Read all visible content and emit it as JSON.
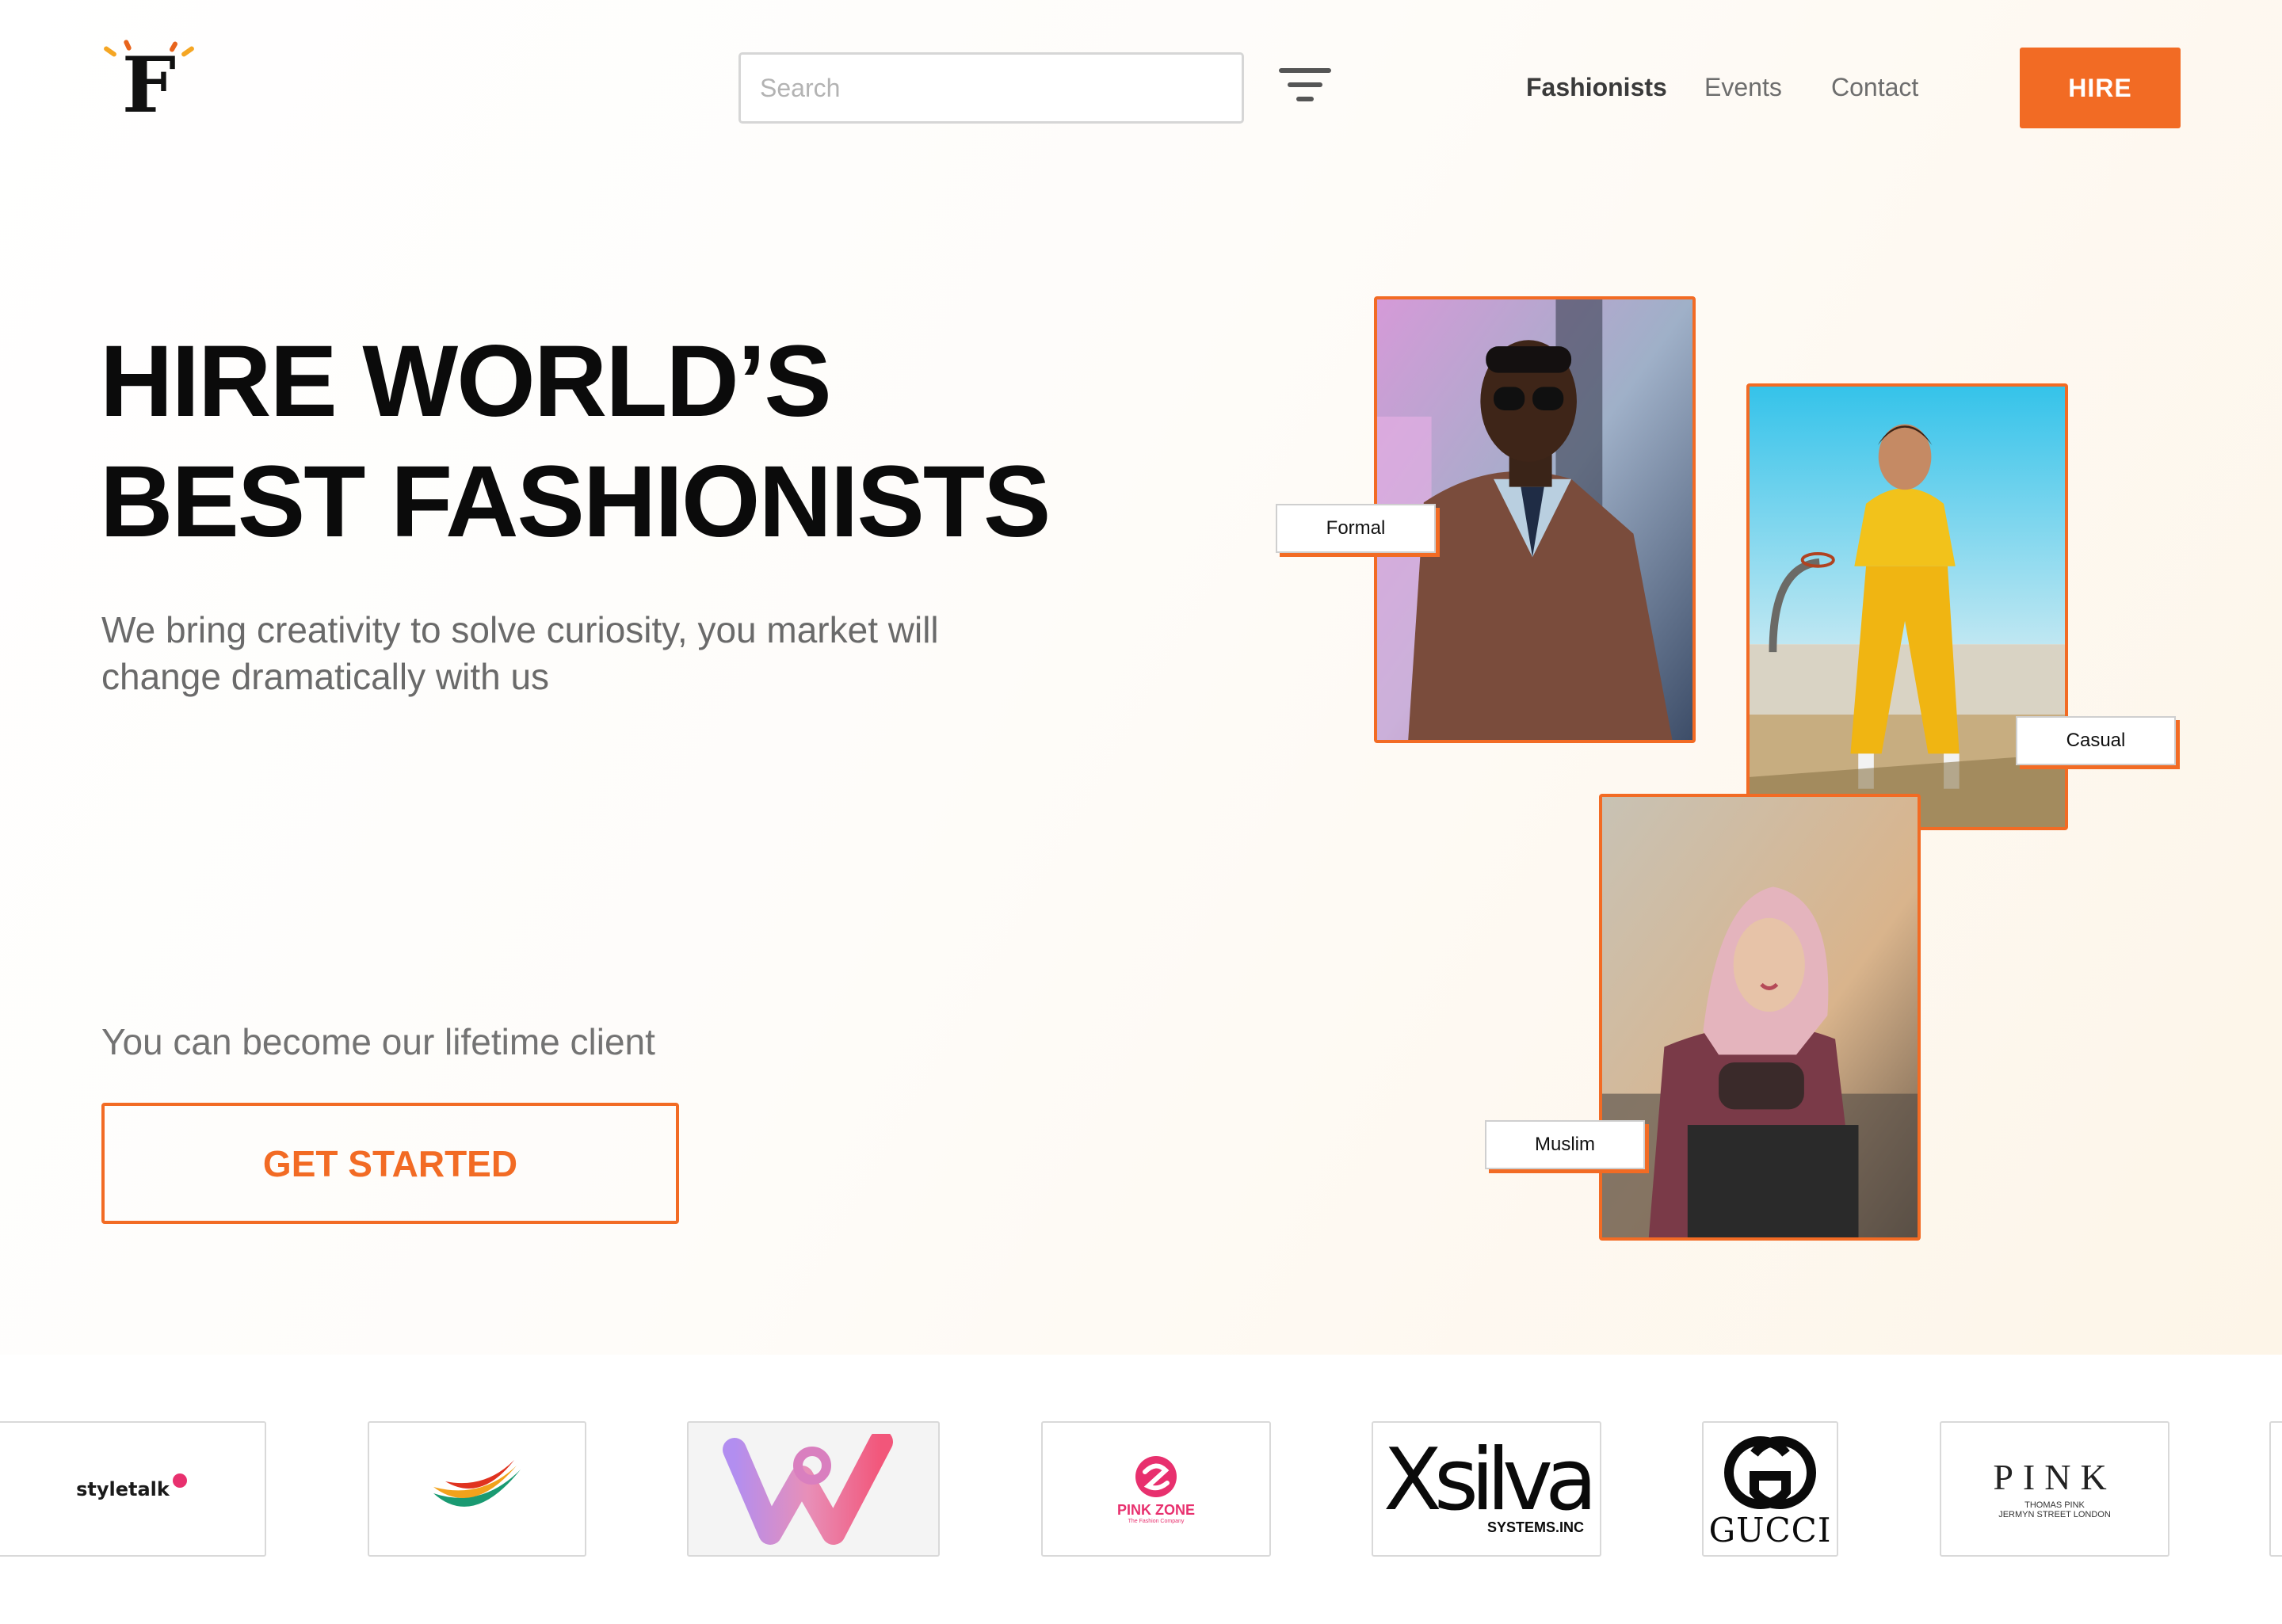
{
  "header": {
    "logo_letter": "F",
    "search_placeholder": "Search",
    "nav": [
      "Fashionists",
      "Events",
      "Contact"
    ],
    "hire_label": "HIRE"
  },
  "hero": {
    "title_line1": "HIRE WORLD’S",
    "title_line2": "BEST FASHIONISTS",
    "subtitle": "We bring creativity to solve curiosity, you market will change dramatically with us",
    "lifetime_text": "You can become our lifetime client",
    "cta_label": "GET STARTED"
  },
  "categories": [
    "Formal",
    "Casual",
    "Muslim"
  ],
  "brands": {
    "styletalk": "styletalk",
    "pinkzone": "PINK ZONE",
    "pinkzone_tagline": "The Fashion Company",
    "xsilva": "Xsilva",
    "xsilva_sub": "SYSTEMS.INC",
    "gucci": "GUCCI",
    "pink": "PINK",
    "pink_sub1": "THOMAS PINK",
    "pink_sub2": "JERMYN STREET LONDON"
  },
  "colors": {
    "accent": "#f26b24",
    "title": "#0b0b0b",
    "body_text": "#6a6a6a"
  }
}
